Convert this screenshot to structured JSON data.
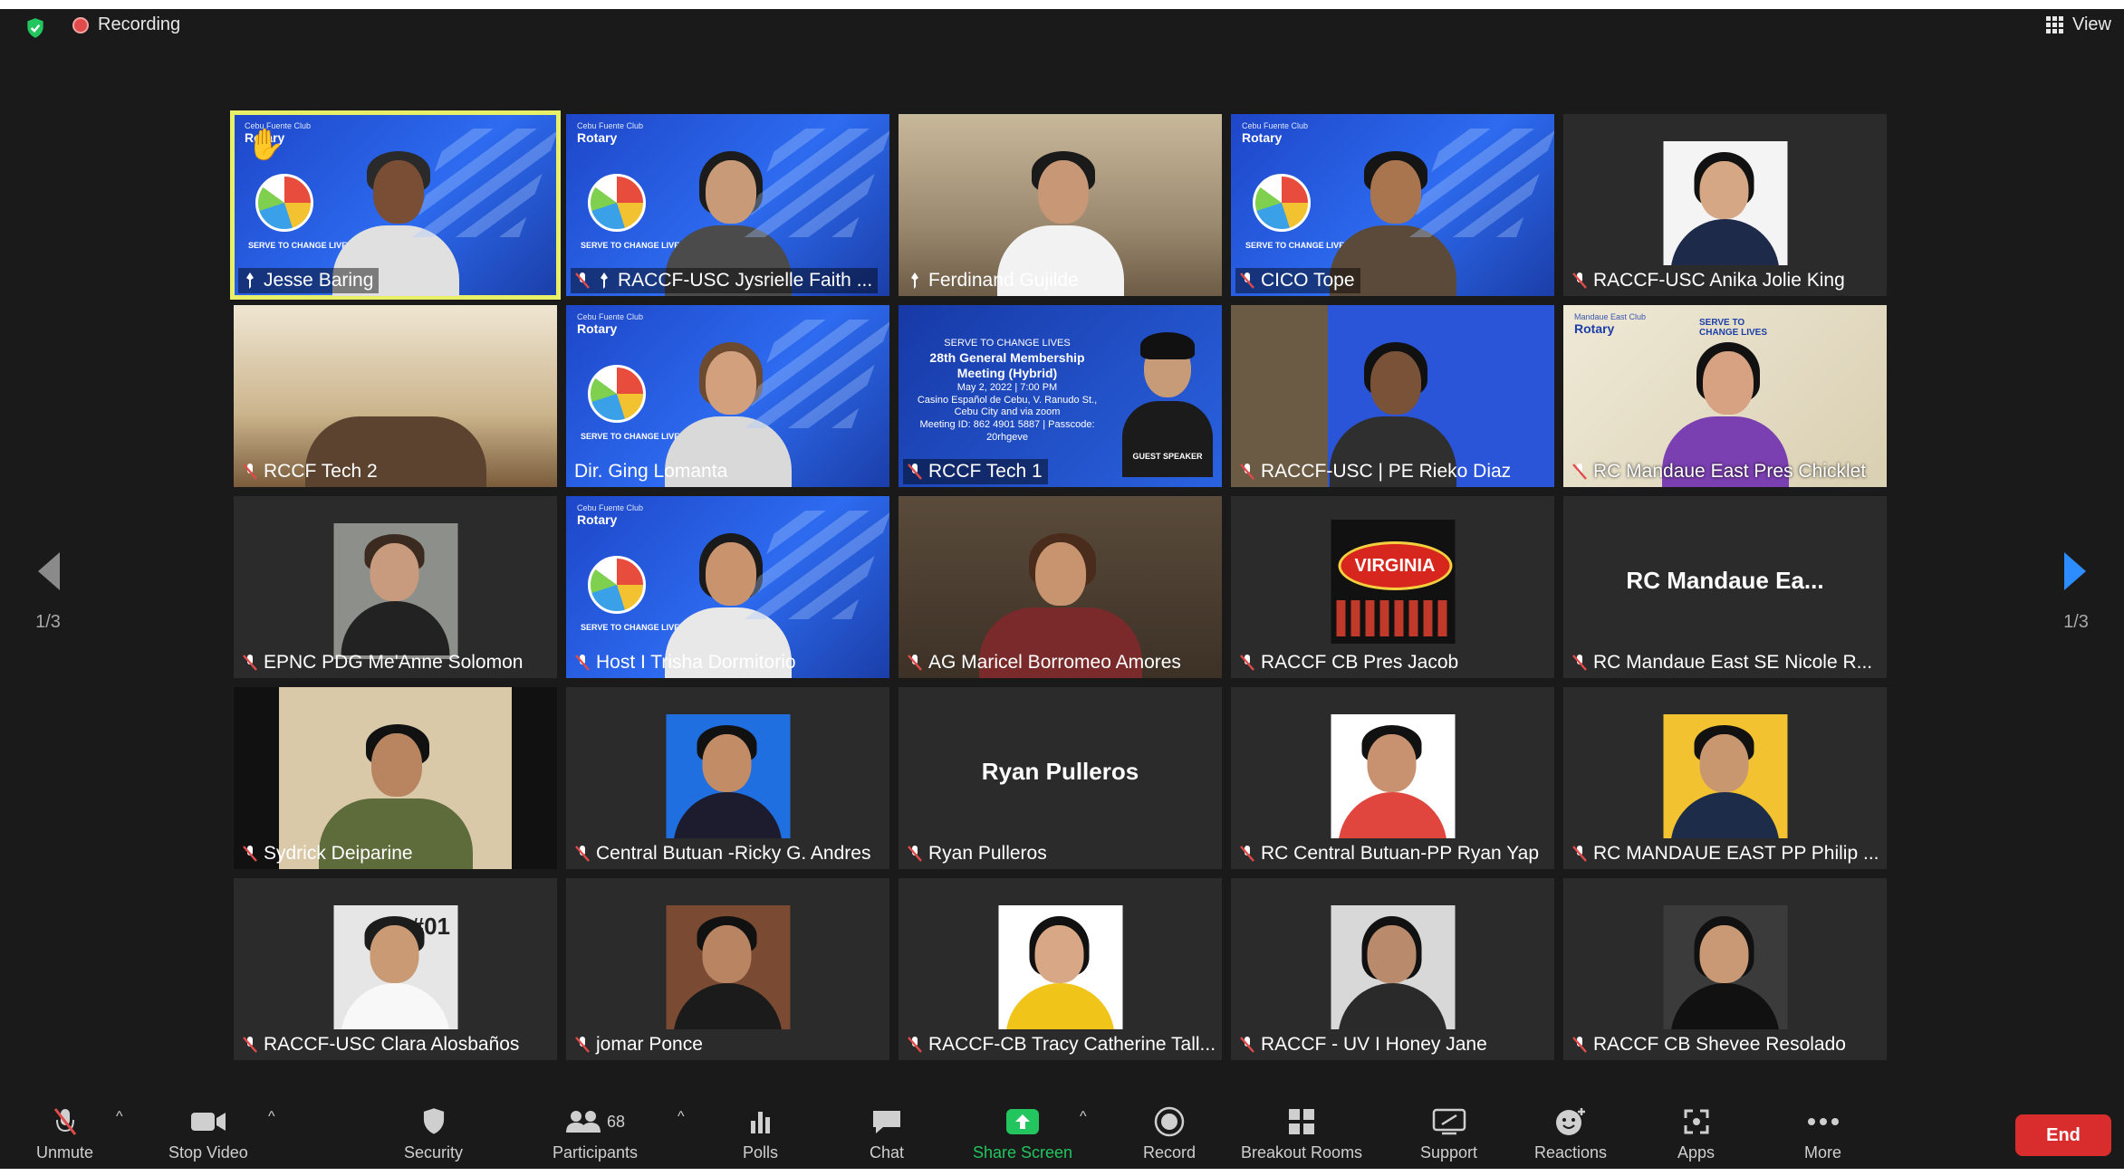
{
  "topbar": {
    "recording_label": "Recording",
    "view_label": "View"
  },
  "pagination": {
    "left_label": "1/3",
    "right_label": "1/3"
  },
  "tiles": [
    {
      "name": "Jesse Baring",
      "club": "Rotary",
      "club_sub": "Cebu Fuente Club",
      "motto": "SERVE TO CHANGE LIVES"
    },
    {
      "name": "RACCF-USC Jysrielle Faith ...",
      "club": "Rotary",
      "club_sub": "Cebu Fuente Club",
      "motto": "SERVE TO CHANGE LIVES"
    },
    {
      "name": "Ferdinand Gujilde"
    },
    {
      "name": "CICO Tope",
      "club": "Rotary",
      "club_sub": "Cebu Fuente Club",
      "motto": "SERVE TO CHANGE LIVES"
    },
    {
      "name": "RACCF-USC Anika Jolie King"
    },
    {
      "name": "RCCF Tech 2"
    },
    {
      "name": "Dir. Ging Lomanta",
      "club": "Rotary",
      "club_sub": "Cebu Fuente Club",
      "motto": "SERVE TO CHANGE LIVES"
    },
    {
      "name": "RCCF Tech 1",
      "poster_title": "28th General Membership Meeting (Hybrid)",
      "poster_date": "May 2, 2022 | 7:00 PM",
      "poster_venue": "Casino Español de Cebu, V. Ranudo St., Cebu City and via zoom",
      "poster_meeting": "Meeting ID: 862 4901 5887 | Passcode: 20rhgeve",
      "poster_tag": "SERVE TO CHANGE LIVES",
      "poster_speaker": "GUEST SPEAKER"
    },
    {
      "name": "RACCF-USC | PE Rieko Diaz"
    },
    {
      "name": "RC Mandaue East Pres Chicklet",
      "club": "Rotary",
      "club_sub": "Mandaue East Club",
      "poster_tag": "SERVE TO CHANGE LIVES"
    },
    {
      "name": "EPNC PDG Me'Anne Solomon"
    },
    {
      "name": "Host I Trisha Dormitorio",
      "club": "Rotary",
      "club_sub": "Cebu Fuente Club",
      "motto": "SERVE TO CHANGE LIVES"
    },
    {
      "name": "AG Maricel Borromeo Amores"
    },
    {
      "name": "RACCF CB Pres Jacob",
      "logo_text": "VIRGINIA"
    },
    {
      "name": "RC Mandaue East SE Nicole R...",
      "display_name": "RC Mandaue Ea..."
    },
    {
      "name": "Sydrick Deiparine"
    },
    {
      "name": "Central Butuan -Ricky G. Andres"
    },
    {
      "name": "Ryan Pulleros",
      "display_name": "Ryan Pulleros"
    },
    {
      "name": "RC Central Butuan-PP Ryan Yap"
    },
    {
      "name": "RC MANDAUE EAST PP Philip ..."
    },
    {
      "name": "RACCF-USC Clara Alosbaños",
      "badge_text": "#01"
    },
    {
      "name": "jomar Ponce"
    },
    {
      "name": "RACCF-CB Tracy Catherine Tall..."
    },
    {
      "name": "RACCF - UV I Honey Jane"
    },
    {
      "name": "RACCF CB Shevee Resolado"
    }
  ],
  "toolbar": {
    "unmute": "Unmute",
    "stop_video": "Stop Video",
    "security": "Security",
    "participants": "Participants",
    "participants_count": "68",
    "polls": "Polls",
    "chat": "Chat",
    "share_screen": "Share Screen",
    "record": "Record",
    "breakout": "Breakout Rooms",
    "support": "Support",
    "reactions": "Reactions",
    "apps": "Apps",
    "more": "More",
    "end": "End"
  },
  "colors": {
    "background": "#1a1a1a",
    "tile": "#2b2b2b",
    "active_speaker": "#e8f06a",
    "end_button": "#d92c2c",
    "share_green": "#22c55e",
    "muted_red": "#e24b4b",
    "page_arrow_active": "#2d8cff"
  }
}
